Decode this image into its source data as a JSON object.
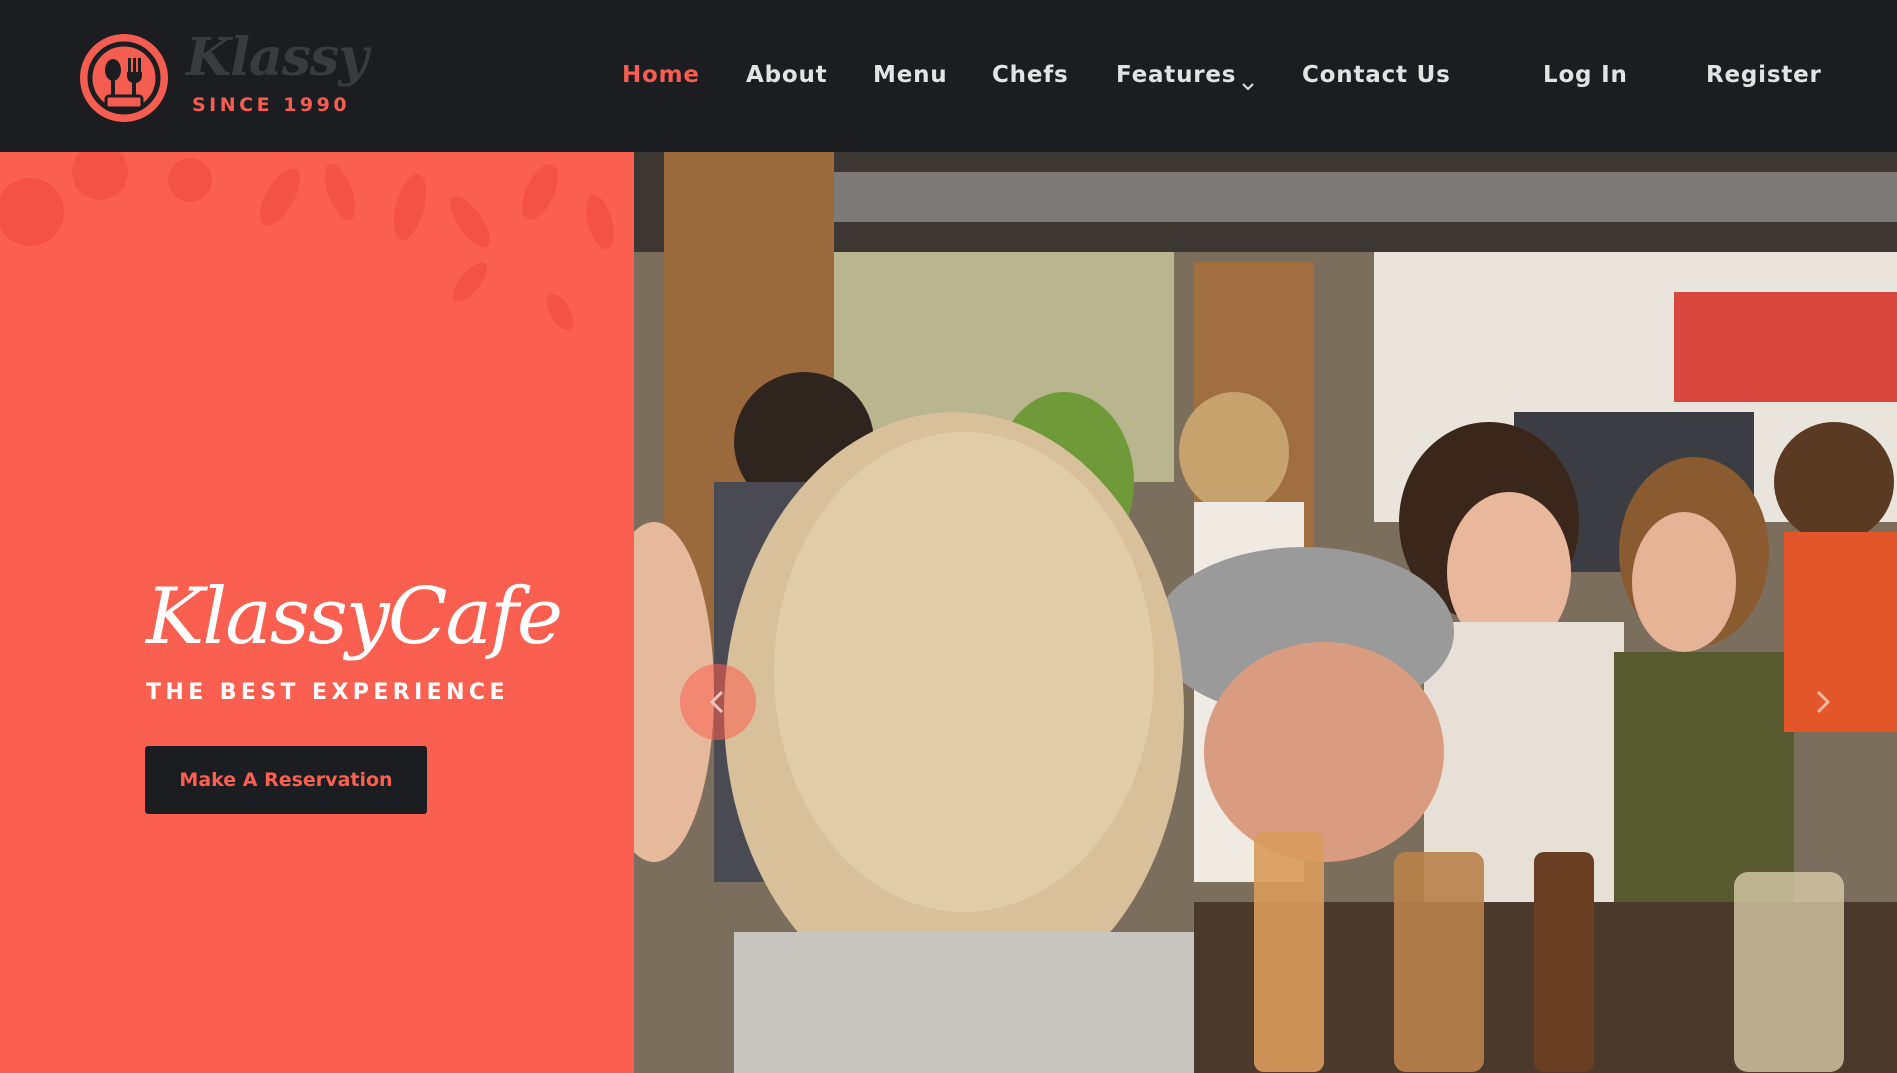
{
  "site": {
    "logo_script": "Klassy",
    "logo_since": "SINCE 1990",
    "logo_icon": "fork-spoon-icon"
  },
  "nav": {
    "items": [
      {
        "label": "Home",
        "active": true
      },
      {
        "label": "About",
        "active": false
      },
      {
        "label": "Menu",
        "active": false
      },
      {
        "label": "Chefs",
        "active": false
      },
      {
        "label": "Features",
        "active": false,
        "has_dropdown": true
      },
      {
        "label": "Contact Us",
        "active": false
      },
      {
        "label": "Log In",
        "active": false
      },
      {
        "label": "Register",
        "active": false
      }
    ]
  },
  "hero": {
    "title": "KlassyCafe",
    "tagline": "THE BEST EXPERIENCE",
    "cta_label": "Make A Reservation",
    "prev_icon": "chevron-left-icon",
    "next_icon": "chevron-right-icon"
  },
  "colors": {
    "accent": "#fb5f50",
    "dark": "#1c1d20",
    "nav_text": "#e3e3e3",
    "logo_script": "#3a3b3f"
  }
}
